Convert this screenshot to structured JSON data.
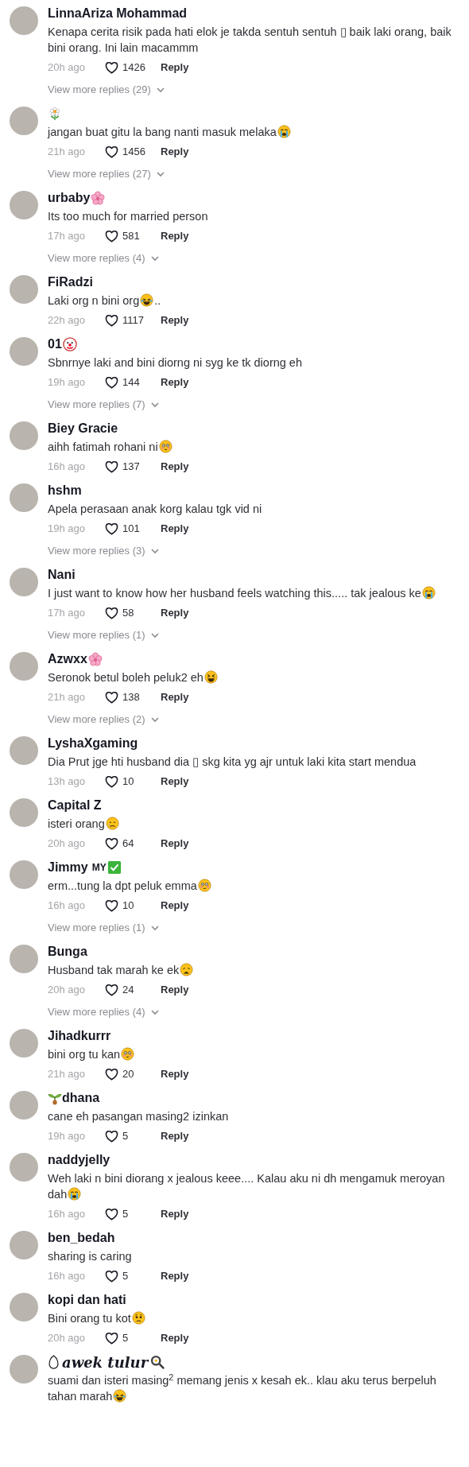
{
  "comments": [
    {
      "name": [
        {
          "kind": "text",
          "text": "LinnaAriza Mohammad"
        }
      ],
      "body": [
        {
          "kind": "text",
          "text": "Kenapa cerita risik pada hati elok je takda sentuh sentuh ▯ baik laki orang, baik bini orang. Ini lain macammm"
        }
      ],
      "time": "20h ago",
      "likes": "1426",
      "reply": "Reply",
      "more_replies": "View more replies (29)"
    },
    {
      "name": [
        {
          "kind": "daisy"
        }
      ],
      "body": [
        {
          "kind": "text",
          "text": "jangan buat gitu la bang nanti masuk melaka"
        },
        {
          "kind": "sob"
        }
      ],
      "time": "21h ago",
      "likes": "1456",
      "reply": "Reply",
      "more_replies": "View more replies (27)"
    },
    {
      "name": [
        {
          "kind": "text",
          "text": "urbaby"
        },
        {
          "kind": "blossom"
        }
      ],
      "body": [
        {
          "kind": "text",
          "text": "Its too much for married person"
        }
      ],
      "time": "17h ago",
      "likes": "581",
      "reply": "Reply",
      "more_replies": "View more replies (4)"
    },
    {
      "name": [
        {
          "kind": "text",
          "text": "FiRadzi"
        }
      ],
      "body": [
        {
          "kind": "text",
          "text": "Laki org n bini org"
        },
        {
          "kind": "joy"
        },
        {
          "kind": "text",
          "text": ".."
        }
      ],
      "time": "22h ago",
      "likes": "1117",
      "reply": "Reply"
    },
    {
      "name": [
        {
          "kind": "text",
          "text": "01"
        },
        {
          "kind": "clown"
        }
      ],
      "body": [
        {
          "kind": "text",
          "text": "Sbnrnye laki and bini diorng ni syg ke tk diorng eh"
        }
      ],
      "time": "19h ago",
      "likes": "144",
      "reply": "Reply",
      "more_replies": "View more replies (7)"
    },
    {
      "name": [
        {
          "kind": "text",
          "text": "Biey Gracie"
        }
      ],
      "body": [
        {
          "kind": "text",
          "text": "aihh fatimah rohani ni"
        },
        {
          "kind": "flushed"
        }
      ],
      "time": "16h ago",
      "likes": "137",
      "reply": "Reply"
    },
    {
      "name": [
        {
          "kind": "text",
          "text": "hshm"
        }
      ],
      "body": [
        {
          "kind": "text",
          "text": "Apela perasaan anak korg kalau tgk vid ni"
        }
      ],
      "time": "19h ago",
      "likes": "101",
      "reply": "Reply",
      "more_replies": "View more replies (3)"
    },
    {
      "name": [
        {
          "kind": "text",
          "text": "Nani"
        }
      ],
      "body": [
        {
          "kind": "text",
          "text": "I just want to know how her husband feels watching this..... tak jealous ke"
        },
        {
          "kind": "sob"
        }
      ],
      "time": "17h ago",
      "likes": "58",
      "reply": "Reply",
      "more_replies": "View more replies (1)"
    },
    {
      "name": [
        {
          "kind": "text",
          "text": "Azwxx"
        },
        {
          "kind": "blossom"
        }
      ],
      "body": [
        {
          "kind": "text",
          "text": "Seronok betul boleh peluk2 eh"
        },
        {
          "kind": "squint"
        }
      ],
      "time": "21h ago",
      "likes": "138",
      "reply": "Reply",
      "more_replies": "View more replies (2)"
    },
    {
      "name": [
        {
          "kind": "text",
          "text": "LyshaXgaming"
        }
      ],
      "body": [
        {
          "kind": "text",
          "text": "Dia Prut jge hti husband dia ▯ skg kita yg ajr untuk laki kita start mendua"
        }
      ],
      "time": "13h ago",
      "likes": "10",
      "reply": "Reply"
    },
    {
      "name": [
        {
          "kind": "text",
          "text": "Capital Z"
        }
      ],
      "body": [
        {
          "kind": "text",
          "text": "isteri orang"
        },
        {
          "kind": "sad"
        }
      ],
      "time": "20h ago",
      "likes": "64",
      "reply": "Reply"
    },
    {
      "name": [
        {
          "kind": "text",
          "text": "Jimmy"
        },
        {
          "kind": "small",
          "text": "MY"
        },
        {
          "kind": "check"
        }
      ],
      "body": [
        {
          "kind": "text",
          "text": "erm...tung la dpt peluk emma"
        },
        {
          "kind": "flushed"
        }
      ],
      "time": "16h ago",
      "likes": "10",
      "reply": "Reply",
      "more_replies": "View more replies (1)"
    },
    {
      "name": [
        {
          "kind": "text",
          "text": "Bunga"
        }
      ],
      "body": [
        {
          "kind": "text",
          "text": "Husband tak marah ke ek"
        },
        {
          "kind": "weary"
        }
      ],
      "time": "20h ago",
      "likes": "24",
      "reply": "Reply",
      "more_replies": "View more replies (4)"
    },
    {
      "name": [
        {
          "kind": "text",
          "text": "Jihadkurrr"
        }
      ],
      "body": [
        {
          "kind": "text",
          "text": "bini org tu kan"
        },
        {
          "kind": "flushed"
        }
      ],
      "time": "21h ago",
      "likes": "20",
      "reply": "Reply"
    },
    {
      "name": [
        {
          "kind": "seedling"
        },
        {
          "kind": "text",
          "text": "dhana"
        }
      ],
      "body": [
        {
          "kind": "text",
          "text": "cane eh pasangan masing2 izinkan"
        }
      ],
      "time": "19h ago",
      "likes": "5",
      "reply": "Reply"
    },
    {
      "name": [
        {
          "kind": "text",
          "text": "naddyjelly"
        }
      ],
      "body": [
        {
          "kind": "text",
          "text": "Weh laki n bini diorang x jealous keee.... Kalau aku ni dh mengamuk meroyan"
        },
        {
          "kind": "text",
          "text": "dah"
        },
        {
          "kind": "sob"
        }
      ],
      "time": "16h ago",
      "likes": "5",
      "reply": "Reply"
    },
    {
      "name": [
        {
          "kind": "text",
          "text": "ben_bedah"
        }
      ],
      "body": [
        {
          "kind": "text",
          "text": "sharing is caring"
        }
      ],
      "time": "16h ago",
      "likes": "5",
      "reply": "Reply"
    },
    {
      "name": [
        {
          "kind": "text",
          "text": "kopi dan hati"
        }
      ],
      "body": [
        {
          "kind": "text",
          "text": "Bini orang tu kot"
        },
        {
          "kind": "frown"
        }
      ],
      "time": "20h ago",
      "likes": "5",
      "reply": "Reply"
    },
    {
      "name": [
        {
          "kind": "egg"
        },
        {
          "kind": "script",
          "text": "awek tulur"
        },
        {
          "kind": "pan"
        }
      ],
      "body": [
        {
          "kind": "text",
          "text": "suami dan isteri masing$^{2}$ memang jenis x kesah ek.. klau aku terus berpeluh"
        },
        {
          "kind": "text",
          "text": "tahan marah"
        },
        {
          "kind": "joy"
        }
      ]
    }
  ]
}
